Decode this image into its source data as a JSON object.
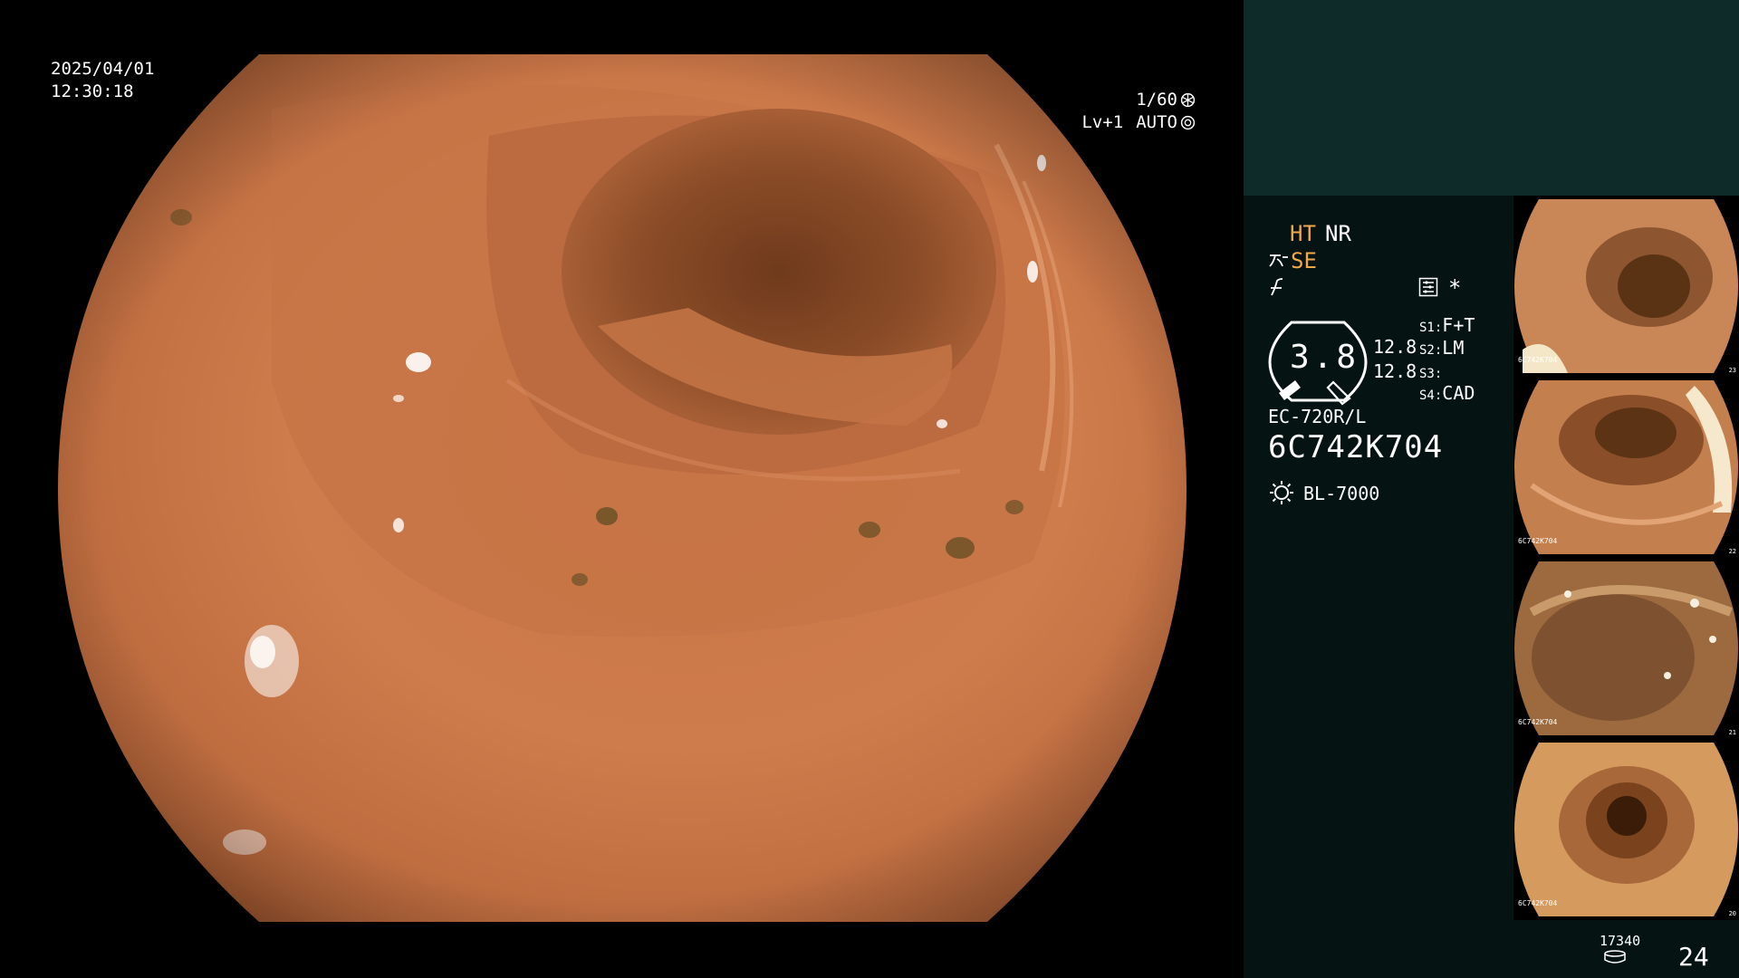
{
  "osd": {
    "date": "2025/04/01",
    "time": "12:30:18",
    "shutter": "1/60",
    "shutter_icon": "iris-icon",
    "level": "Lv+1",
    "exposure_mode": "AUTO",
    "exposure_icon": "aperture-icon"
  },
  "settings": {
    "ht_label": "HT",
    "nr_label": "NR",
    "se_label": "SE",
    "se_icon": "surface-enhance-icon",
    "structure_icon": "structure-icon",
    "menu_icon": "menu-icon",
    "asterisk": "*",
    "colors": {
      "accent": "#f2a84a",
      "panel": "#051413",
      "panel_top": "#0e2a29"
    }
  },
  "gauge": {
    "value": "3.8",
    "value_a": "12.8",
    "value_b": "12.8"
  },
  "switches": [
    {
      "label": "S1",
      "value": "F+T"
    },
    {
      "label": "S2",
      "value": "LM"
    },
    {
      "label": "S3",
      "value": ""
    },
    {
      "label": "S4",
      "value": "CAD"
    }
  ],
  "scope": {
    "model": "EC-720R/L",
    "serial": "6C742K704"
  },
  "light_source": {
    "name": "BL-7000",
    "icon": "lamp-icon"
  },
  "captures": [
    {
      "serial": "6C742K704",
      "number": "23"
    },
    {
      "serial": "6C742K704",
      "number": "22"
    },
    {
      "serial": "6C742K704",
      "number": "21"
    },
    {
      "serial": "6C742K704",
      "number": "20"
    }
  ],
  "footer": {
    "storage_count": "17340",
    "storage_icon": "storage-icon",
    "page_number": "24"
  }
}
